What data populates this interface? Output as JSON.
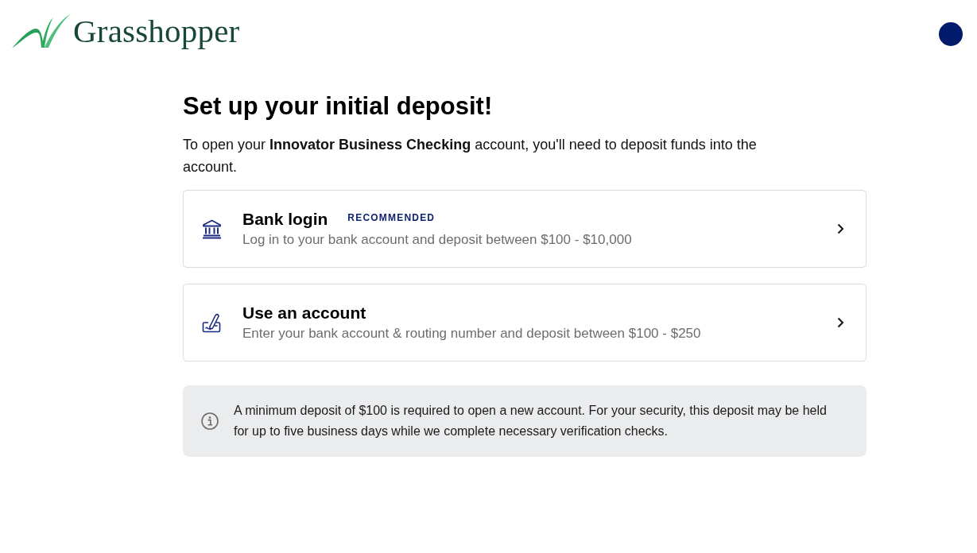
{
  "header": {
    "logo_text": "Grasshopper"
  },
  "heading": "Set up your initial deposit!",
  "intro": "To open your **Innovator Business Checking** account, you'll need to deposit funds into the account.",
  "options": [
    {
      "kind": "bank",
      "title": "Bank login",
      "badge": "RECOMMENDED",
      "description": "Log in to your bank account and deposit between $100 - $10,000"
    },
    {
      "kind": "check",
      "title": "Use an account",
      "description": "Enter your bank account & routing number and deposit between $100 - $250"
    }
  ],
  "notice": {
    "text": "A minimum deposit of $100 is required to open a new account. For your security, this deposit may be held for up to five business days while we complete necessary verification checks."
  }
}
